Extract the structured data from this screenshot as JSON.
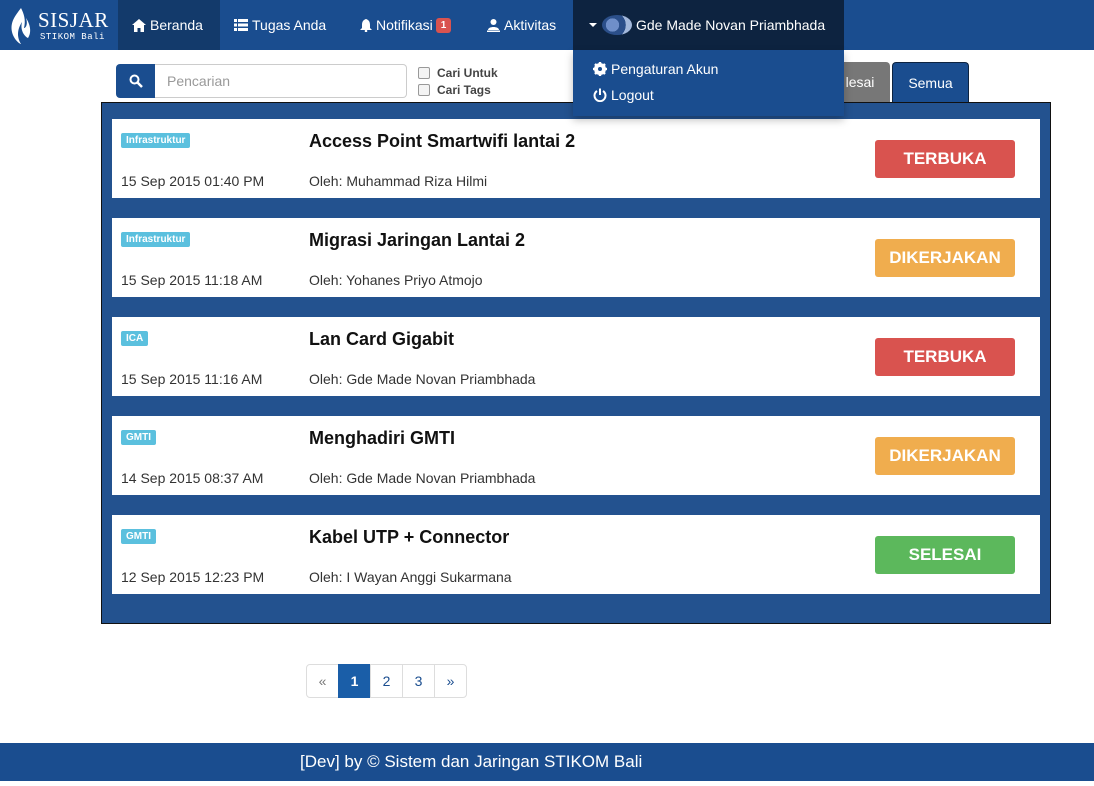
{
  "brand": {
    "title": "SISJAR",
    "subtitle": "STIKOM Bali"
  },
  "nav": {
    "beranda": "Beranda",
    "tugas": "Tugas Anda",
    "notifikasi": "Notifikasi",
    "notif_count": "1",
    "aktivitas": "Aktivitas",
    "user_name": "Gde Made Novan Priambhada"
  },
  "dropdown": {
    "settings": "Pengaturan Akun",
    "logout": "Logout"
  },
  "search": {
    "placeholder": "Pencarian",
    "option_1": "Cari Untuk",
    "option_2": "Cari Tags"
  },
  "tabs": {
    "selesai": "lesai",
    "semua": "Semua"
  },
  "tasks": [
    {
      "tag": "Infrastruktur",
      "title": "Access Point Smartwifi lantai 2",
      "date": "15 Sep 2015 01:40 PM",
      "author": "Oleh: Muhammad Riza Hilmi",
      "status": "TERBUKA",
      "status_color": "#d9534f"
    },
    {
      "tag": "Infrastruktur",
      "title": "Migrasi Jaringan Lantai 2",
      "date": "15 Sep 2015 11:18 AM",
      "author": "Oleh: Yohanes Priyo Atmojo",
      "status": "DIKERJAKAN",
      "status_color": "#f0ad4e"
    },
    {
      "tag": "ICA",
      "title": "Lan Card Gigabit",
      "date": "15 Sep 2015 11:16 AM",
      "author": "Oleh: Gde Made Novan Priambhada",
      "status": "TERBUKA",
      "status_color": "#d9534f"
    },
    {
      "tag": "GMTI",
      "title": "Menghadiri GMTI",
      "date": "14 Sep 2015 08:37 AM",
      "author": "Oleh: Gde Made Novan Priambhada",
      "status": "DIKERJAKAN",
      "status_color": "#f0ad4e"
    },
    {
      "tag": "GMTI",
      "title": "Kabel UTP + Connector",
      "date": "12 Sep 2015 12:23 PM",
      "author": "Oleh: I Wayan Anggi Sukarmana",
      "status": "SELESAI",
      "status_color": "#5cb85c"
    }
  ],
  "pagination": {
    "prev": "«",
    "pages": [
      "1",
      "2",
      "3"
    ],
    "current": "1",
    "next": "»"
  },
  "footer": {
    "text": "[Dev] by © Sistem dan Jaringan STIKOM Bali"
  }
}
